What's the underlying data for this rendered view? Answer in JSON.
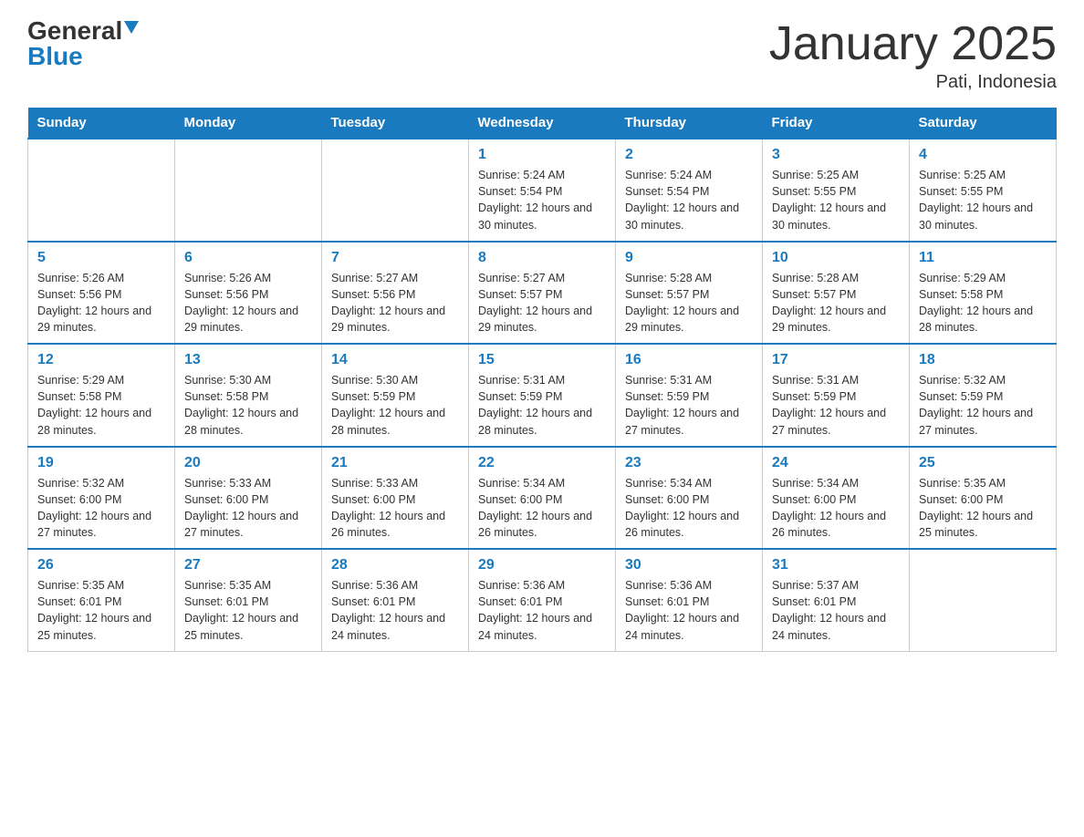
{
  "header": {
    "logo_general": "General",
    "logo_blue": "Blue",
    "month_title": "January 2025",
    "location": "Pati, Indonesia"
  },
  "days_of_week": [
    "Sunday",
    "Monday",
    "Tuesday",
    "Wednesday",
    "Thursday",
    "Friday",
    "Saturday"
  ],
  "weeks": [
    [
      {
        "day": "",
        "info": ""
      },
      {
        "day": "",
        "info": ""
      },
      {
        "day": "",
        "info": ""
      },
      {
        "day": "1",
        "info": "Sunrise: 5:24 AM\nSunset: 5:54 PM\nDaylight: 12 hours and 30 minutes."
      },
      {
        "day": "2",
        "info": "Sunrise: 5:24 AM\nSunset: 5:54 PM\nDaylight: 12 hours and 30 minutes."
      },
      {
        "day": "3",
        "info": "Sunrise: 5:25 AM\nSunset: 5:55 PM\nDaylight: 12 hours and 30 minutes."
      },
      {
        "day": "4",
        "info": "Sunrise: 5:25 AM\nSunset: 5:55 PM\nDaylight: 12 hours and 30 minutes."
      }
    ],
    [
      {
        "day": "5",
        "info": "Sunrise: 5:26 AM\nSunset: 5:56 PM\nDaylight: 12 hours and 29 minutes."
      },
      {
        "day": "6",
        "info": "Sunrise: 5:26 AM\nSunset: 5:56 PM\nDaylight: 12 hours and 29 minutes."
      },
      {
        "day": "7",
        "info": "Sunrise: 5:27 AM\nSunset: 5:56 PM\nDaylight: 12 hours and 29 minutes."
      },
      {
        "day": "8",
        "info": "Sunrise: 5:27 AM\nSunset: 5:57 PM\nDaylight: 12 hours and 29 minutes."
      },
      {
        "day": "9",
        "info": "Sunrise: 5:28 AM\nSunset: 5:57 PM\nDaylight: 12 hours and 29 minutes."
      },
      {
        "day": "10",
        "info": "Sunrise: 5:28 AM\nSunset: 5:57 PM\nDaylight: 12 hours and 29 minutes."
      },
      {
        "day": "11",
        "info": "Sunrise: 5:29 AM\nSunset: 5:58 PM\nDaylight: 12 hours and 28 minutes."
      }
    ],
    [
      {
        "day": "12",
        "info": "Sunrise: 5:29 AM\nSunset: 5:58 PM\nDaylight: 12 hours and 28 minutes."
      },
      {
        "day": "13",
        "info": "Sunrise: 5:30 AM\nSunset: 5:58 PM\nDaylight: 12 hours and 28 minutes."
      },
      {
        "day": "14",
        "info": "Sunrise: 5:30 AM\nSunset: 5:59 PM\nDaylight: 12 hours and 28 minutes."
      },
      {
        "day": "15",
        "info": "Sunrise: 5:31 AM\nSunset: 5:59 PM\nDaylight: 12 hours and 28 minutes."
      },
      {
        "day": "16",
        "info": "Sunrise: 5:31 AM\nSunset: 5:59 PM\nDaylight: 12 hours and 27 minutes."
      },
      {
        "day": "17",
        "info": "Sunrise: 5:31 AM\nSunset: 5:59 PM\nDaylight: 12 hours and 27 minutes."
      },
      {
        "day": "18",
        "info": "Sunrise: 5:32 AM\nSunset: 5:59 PM\nDaylight: 12 hours and 27 minutes."
      }
    ],
    [
      {
        "day": "19",
        "info": "Sunrise: 5:32 AM\nSunset: 6:00 PM\nDaylight: 12 hours and 27 minutes."
      },
      {
        "day": "20",
        "info": "Sunrise: 5:33 AM\nSunset: 6:00 PM\nDaylight: 12 hours and 27 minutes."
      },
      {
        "day": "21",
        "info": "Sunrise: 5:33 AM\nSunset: 6:00 PM\nDaylight: 12 hours and 26 minutes."
      },
      {
        "day": "22",
        "info": "Sunrise: 5:34 AM\nSunset: 6:00 PM\nDaylight: 12 hours and 26 minutes."
      },
      {
        "day": "23",
        "info": "Sunrise: 5:34 AM\nSunset: 6:00 PM\nDaylight: 12 hours and 26 minutes."
      },
      {
        "day": "24",
        "info": "Sunrise: 5:34 AM\nSunset: 6:00 PM\nDaylight: 12 hours and 26 minutes."
      },
      {
        "day": "25",
        "info": "Sunrise: 5:35 AM\nSunset: 6:00 PM\nDaylight: 12 hours and 25 minutes."
      }
    ],
    [
      {
        "day": "26",
        "info": "Sunrise: 5:35 AM\nSunset: 6:01 PM\nDaylight: 12 hours and 25 minutes."
      },
      {
        "day": "27",
        "info": "Sunrise: 5:35 AM\nSunset: 6:01 PM\nDaylight: 12 hours and 25 minutes."
      },
      {
        "day": "28",
        "info": "Sunrise: 5:36 AM\nSunset: 6:01 PM\nDaylight: 12 hours and 24 minutes."
      },
      {
        "day": "29",
        "info": "Sunrise: 5:36 AM\nSunset: 6:01 PM\nDaylight: 12 hours and 24 minutes."
      },
      {
        "day": "30",
        "info": "Sunrise: 5:36 AM\nSunset: 6:01 PM\nDaylight: 12 hours and 24 minutes."
      },
      {
        "day": "31",
        "info": "Sunrise: 5:37 AM\nSunset: 6:01 PM\nDaylight: 12 hours and 24 minutes."
      },
      {
        "day": "",
        "info": ""
      }
    ]
  ]
}
